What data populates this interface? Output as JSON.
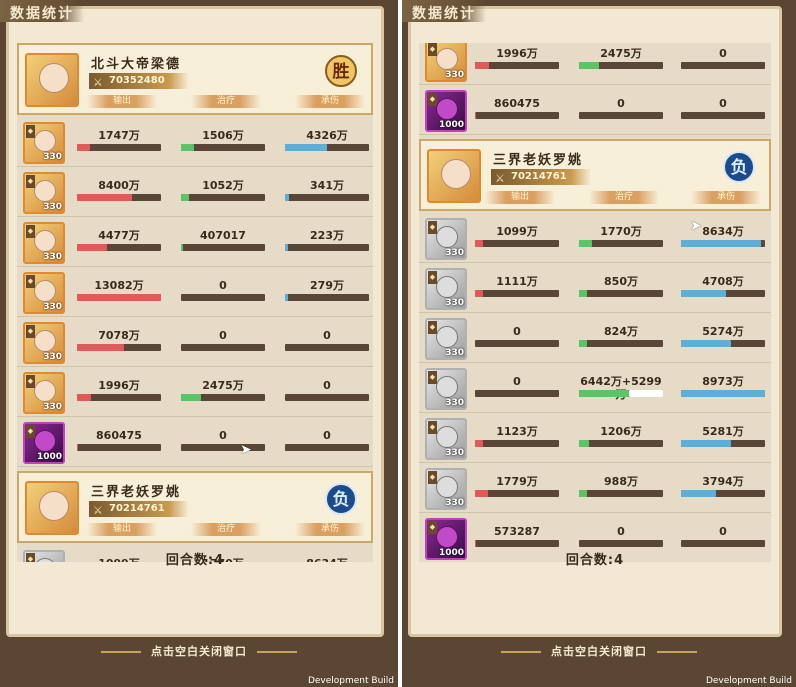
{
  "title": "数据统计",
  "rounds": "回合数:4",
  "close_tip": "点击空白关闭窗口",
  "dev_build": "Development Build",
  "labels": {
    "output": "输出",
    "heal": "治疗",
    "dmg_taken": "承伤"
  },
  "teams": {
    "winner": {
      "name": "北斗大帝梁德",
      "score": "70352480",
      "result": "胜"
    },
    "loser": {
      "name": "三界老妖罗姚",
      "score": "70214761",
      "result": "负"
    }
  },
  "winner_rows": [
    {
      "level": "330",
      "avatar": "gold",
      "output": "1747万",
      "output_pct": 0.16,
      "heal": "1506万",
      "heal_pct": 0.15,
      "taken": "4326万",
      "taken_pct": 0.5
    },
    {
      "level": "330",
      "avatar": "gold",
      "output": "8400万",
      "output_pct": 0.66,
      "heal": "1052万",
      "heal_pct": 0.1,
      "taken": "341万",
      "taken_pct": 0.05
    },
    {
      "level": "330",
      "avatar": "gold",
      "output": "4477万",
      "output_pct": 0.36,
      "heal": "407017",
      "heal_pct": 0.02,
      "taken": "223万",
      "taken_pct": 0.03
    },
    {
      "level": "330",
      "avatar": "gold",
      "output": "13082万",
      "output_pct": 1.0,
      "heal": "0",
      "heal_pct": 0,
      "taken": "279万",
      "taken_pct": 0.04
    },
    {
      "level": "330",
      "avatar": "gold",
      "output": "7078万",
      "output_pct": 0.56,
      "heal": "0",
      "heal_pct": 0,
      "taken": "0",
      "taken_pct": 0
    },
    {
      "level": "330",
      "avatar": "gold",
      "output": "1996万",
      "output_pct": 0.17,
      "heal": "2475万",
      "heal_pct": 0.24,
      "taken": "0",
      "taken_pct": 0
    },
    {
      "level": "1000",
      "avatar": "purple",
      "output": "860475",
      "output_pct": 0.01,
      "heal": "0",
      "heal_pct": 0,
      "taken": "0",
      "taken_pct": 0
    }
  ],
  "left_partial_row": {
    "level": "330",
    "output": "1099万",
    "heal": "1770万",
    "taken": "8634万"
  },
  "right_top_rows": [
    {
      "level": "330",
      "avatar": "gold",
      "output": "1996万",
      "output_pct": 0.17,
      "heal": "2475万",
      "heal_pct": 0.24,
      "taken": "0",
      "taken_pct": 0
    },
    {
      "level": "1000",
      "avatar": "purple",
      "output": "860475",
      "output_pct": 0.01,
      "heal": "0",
      "heal_pct": 0,
      "taken": "0",
      "taken_pct": 0
    }
  ],
  "loser_rows": [
    {
      "level": "330",
      "avatar": "grey",
      "output": "1099万",
      "output_pct": 0.1,
      "heal": "1770万",
      "heal_pct": 0.16,
      "taken": "8634万",
      "taken_pct": 0.95
    },
    {
      "level": "330",
      "avatar": "grey",
      "output": "1111万",
      "output_pct": 0.1,
      "heal": "850万",
      "heal_pct": 0.09,
      "taken": "4708万",
      "taken_pct": 0.53
    },
    {
      "level": "330",
      "avatar": "grey",
      "output": "0",
      "output_pct": 0,
      "heal": "824万",
      "heal_pct": 0.09,
      "taken": "5274万",
      "taken_pct": 0.59
    },
    {
      "level": "330",
      "avatar": "grey",
      "output": "0",
      "output_pct": 0,
      "heal": "6442万+5299万",
      "heal_pct": 0.6,
      "heal_extra_pct": 0.4,
      "taken": "8973万",
      "taken_pct": 1.0
    },
    {
      "level": "330",
      "avatar": "grey",
      "output": "1123万",
      "output_pct": 0.1,
      "heal": "1206万",
      "heal_pct": 0.12,
      "taken": "5281万",
      "taken_pct": 0.59
    },
    {
      "level": "330",
      "avatar": "grey",
      "output": "1779万",
      "output_pct": 0.16,
      "heal": "988万",
      "heal_pct": 0.1,
      "taken": "3794万",
      "taken_pct": 0.42
    },
    {
      "level": "1000",
      "avatar": "purple",
      "output": "573287",
      "output_pct": 0.01,
      "heal": "0",
      "heal_pct": 0,
      "taken": "0",
      "taken_pct": 0
    }
  ]
}
